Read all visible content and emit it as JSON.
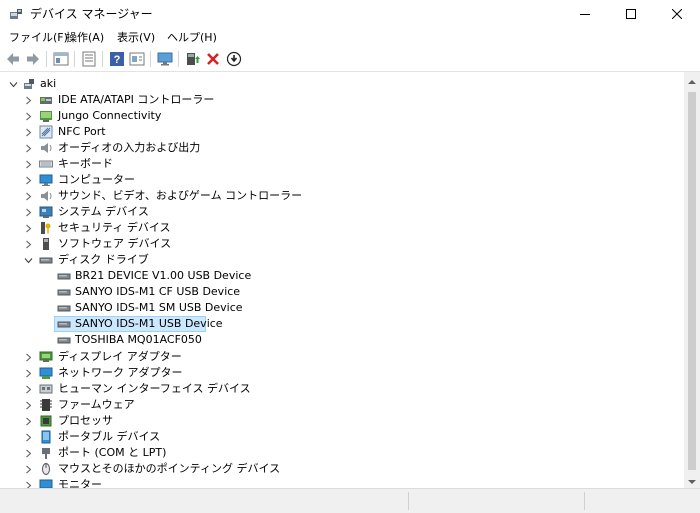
{
  "window": {
    "title": "デバイス マネージャー"
  },
  "menu": [
    "ファイル(F)",
    "操作(A)",
    "表示(V)",
    "ヘルプ(H)"
  ],
  "toolbar": {
    "buttons": [
      "back-arrow-icon",
      "forward-arrow-icon",
      "properties-icon",
      "list-icon",
      "help-icon",
      "view-icon",
      "monitor-scan-icon",
      "update-driver-icon",
      "uninstall-icon",
      "download-icon"
    ]
  },
  "tree": {
    "root": "aki",
    "nodes": [
      {
        "label": "IDE ATA/ATAPI コントローラー",
        "icon": "ide-controller-icon"
      },
      {
        "label": "Jungo Connectivity",
        "icon": "jungo-icon"
      },
      {
        "label": "NFC Port",
        "icon": "nfc-icon"
      },
      {
        "label": "オーディオの入力および出力",
        "icon": "speaker-icon"
      },
      {
        "label": "キーボード",
        "icon": "keyboard-icon"
      },
      {
        "label": "コンピューター",
        "icon": "computer-icon"
      },
      {
        "label": "サウンド、ビデオ、およびゲーム コントローラー",
        "icon": "sound-icon"
      },
      {
        "label": "システム デバイス",
        "icon": "system-device-icon"
      },
      {
        "label": "セキュリティ デバイス",
        "icon": "security-key-icon"
      },
      {
        "label": "ソフトウェア デバイス",
        "icon": "software-device-icon"
      },
      {
        "label": "ディスク ドライブ",
        "icon": "disk-drive-icon",
        "expanded": true
      },
      {
        "label": "ディスプレイ アダプター",
        "icon": "display-adapter-icon"
      },
      {
        "label": "ネットワーク アダプター",
        "icon": "network-adapter-icon"
      },
      {
        "label": "ヒューマン インターフェイス デバイス",
        "icon": "hid-icon"
      },
      {
        "label": "ファームウェア",
        "icon": "firmware-icon"
      },
      {
        "label": "プロセッサ",
        "icon": "processor-icon"
      },
      {
        "label": "ポータブル デバイス",
        "icon": "portable-device-icon"
      },
      {
        "label": "ポート (COM と LPT)",
        "icon": "port-icon"
      },
      {
        "label": "マウスとそのほかのポインティング デバイス",
        "icon": "mouse-icon"
      },
      {
        "label": "モニター",
        "icon": "monitor-icon"
      }
    ],
    "disk_children": [
      {
        "label": "BR21  DEVICE V1.00 USB Device"
      },
      {
        "label": "SANYO IDS-M1 CF USB Device"
      },
      {
        "label": "SANYO IDS-M1 SM USB Device"
      },
      {
        "label": "SANYO IDS-M1 USB Device",
        "selected": true
      },
      {
        "label": "TOSHIBA MQ01ACF050"
      }
    ]
  },
  "colors": {
    "selection": "#cce8ff",
    "selection_border": "#99d1ff",
    "titlebar": "#ffffff"
  }
}
